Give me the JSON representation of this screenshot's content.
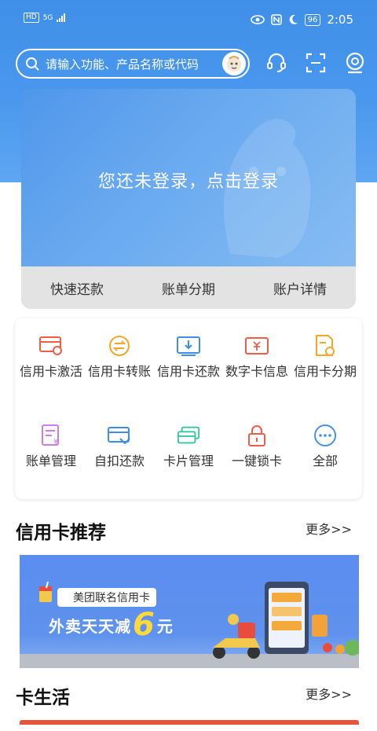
{
  "status_bar": {
    "left_badge": "HD",
    "signal_text": "5G",
    "battery": "96",
    "time": "2:05"
  },
  "search": {
    "placeholder": "请输入功能、产品名称或代码"
  },
  "login_card": {
    "prompt": "您还未登录，点击登录",
    "quick_actions": [
      "快速还款",
      "账单分期",
      "账户详情"
    ]
  },
  "functions": {
    "items": [
      {
        "label": "信用卡激活",
        "icon": "card-activate-icon",
        "color": "#e8604c"
      },
      {
        "label": "信用卡转账",
        "icon": "transfer-icon",
        "color": "#f4a82a"
      },
      {
        "label": "信用卡还款",
        "icon": "repay-icon",
        "color": "#3d8fe6"
      },
      {
        "label": "数字卡信息",
        "icon": "digital-card-icon",
        "color": "#e8604c"
      },
      {
        "label": "信用卡分期",
        "icon": "installment-icon",
        "color": "#f4a82a"
      },
      {
        "label": "账单管理",
        "icon": "bill-icon",
        "color": "#c97ee8"
      },
      {
        "label": "自扣还款",
        "icon": "auto-debit-icon",
        "color": "#3d8fe6"
      },
      {
        "label": "卡片管理",
        "icon": "card-manage-icon",
        "color": "#3cc49a"
      },
      {
        "label": "一键锁卡",
        "icon": "lock-icon",
        "color": "#e8604c"
      },
      {
        "label": "全部",
        "icon": "more-icon",
        "color": "#4a8fe8"
      }
    ]
  },
  "recommend": {
    "title": "信用卡推荐",
    "more": "更多>>",
    "banner": {
      "tag": "美团联名信用卡",
      "headline": "外卖天天减",
      "amount": "6",
      "unit": "元"
    }
  },
  "card_life": {
    "title": "卡生活",
    "more": "更多>>"
  },
  "colors": {
    "brand_blue": "#3f8fe8",
    "accent_yellow": "#ffd83a"
  }
}
